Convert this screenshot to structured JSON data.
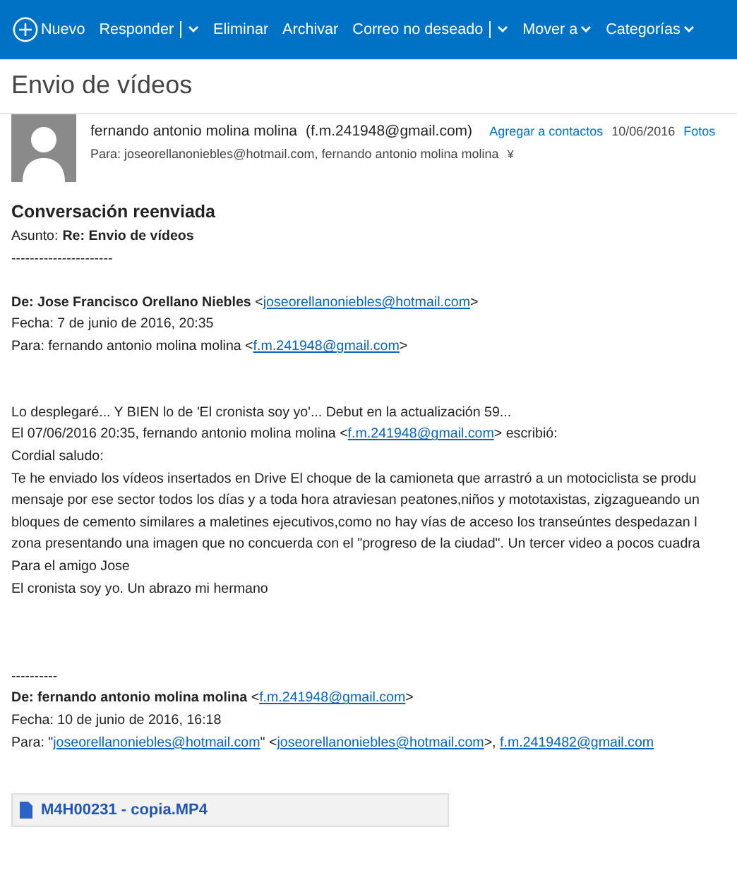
{
  "toolbar": [
    {
      "label": "Nuevo",
      "kind": "new"
    },
    {
      "label": "Responder",
      "kind": "split"
    },
    {
      "label": "Eliminar",
      "kind": "plain"
    },
    {
      "label": "Archivar",
      "kind": "plain"
    },
    {
      "label": "Correo no deseado",
      "kind": "split"
    },
    {
      "label": "Mover a",
      "kind": "menu"
    },
    {
      "label": "Categorías",
      "kind": "menu"
    }
  ],
  "subject": "Envio de vídeos",
  "message_header": {
    "sender": "fernando antonio molina molina",
    "sender_email": "(f.m.241948@gmail.com)",
    "add_contact": "Agregar a contactos",
    "date": "10/06/2016",
    "photos": "Fotos",
    "recipients": "Para: joseorellanoniebles@hotmail.com, fernando antonio molina molina",
    "expand": "¥"
  },
  "body": [
    {
      "kind": "heading",
      "parts": [
        {
          "kind": "bold",
          "text": "Conversación reenviada"
        }
      ]
    },
    {
      "kind": "line",
      "parts": [
        {
          "kind": "text",
          "text": "Asunto:"
        },
        {
          "kind": "bold",
          "text": "Re: Envio de vídeos"
        }
      ]
    },
    {
      "kind": "line",
      "parts": [
        {
          "kind": "text",
          "text": "----------------------"
        }
      ]
    },
    {
      "kind": "gap"
    },
    {
      "kind": "line",
      "parts": [
        {
          "kind": "bold",
          "text": "De: Jose Francisco Orellano Niebles"
        },
        {
          "kind": "text",
          "text": " <"
        },
        {
          "kind": "link",
          "text": "joseorellanoniebles@hotmail.com"
        },
        {
          "kind": "text",
          "text": ">"
        }
      ]
    },
    {
      "kind": "line",
      "parts": [
        {
          "kind": "text",
          "text": "Fecha: 7 de junio de 2016, 20:35"
        }
      ]
    },
    {
      "kind": "line",
      "parts": [
        {
          "kind": "text",
          "text": "Para: fernando antonio molina molina <"
        },
        {
          "kind": "link",
          "text": "f.m.241948@gmail.com"
        },
        {
          "kind": "text",
          "text": ">"
        }
      ]
    },
    {
      "kind": "gap"
    },
    {
      "kind": "gap"
    },
    {
      "kind": "line",
      "parts": [
        {
          "kind": "text",
          "text": "Lo desplegaré... Y BIEN lo de 'El cronista soy yo'... Debut en la actualización 59..."
        }
      ]
    },
    {
      "kind": "line",
      "parts": [
        {
          "kind": "text",
          "text": "El 07/06/2016 20:35, fernando antonio molina molina <"
        },
        {
          "kind": "link",
          "text": "f.m.241948@gmail.com"
        },
        {
          "kind": "text",
          "text": "> escribió:"
        }
      ]
    },
    {
      "kind": "line",
      "parts": [
        {
          "kind": "text",
          "text": "Cordial saludo:"
        }
      ]
    },
    {
      "kind": "line",
      "parts": [
        {
          "kind": "text",
          "text": "Te he enviado los vídeos insertados en Drive El choque de la camioneta que arrastró a un motociclista se produ"
        }
      ]
    },
    {
      "kind": "line",
      "parts": [
        {
          "kind": "text",
          "text": "mensaje por ese sector todos los días y a toda hora atraviesan peatones,niños y mototaxistas, zigzagueando un"
        }
      ]
    },
    {
      "kind": "line",
      "parts": [
        {
          "kind": "text",
          "text": "bloques de cemento similares a maletines ejecutivos,como no hay vías de acceso los transeúntes despedazan l"
        }
      ]
    },
    {
      "kind": "line",
      "parts": [
        {
          "kind": "text",
          "text": "zona presentando una imagen que no concuerda con el \"progreso de la ciudad\". Un tercer video a pocos cuadra"
        }
      ]
    },
    {
      "kind": "line",
      "parts": [
        {
          "kind": "text",
          "text": "Para el amigo Jose"
        }
      ]
    },
    {
      "kind": "line",
      "parts": [
        {
          "kind": "text",
          "text": "El cronista soy yo. Un abrazo mi hermano"
        }
      ]
    },
    {
      "kind": "gap"
    },
    {
      "kind": "gap"
    },
    {
      "kind": "gap"
    },
    {
      "kind": "line",
      "parts": [
        {
          "kind": "text",
          "text": "----------"
        }
      ]
    },
    {
      "kind": "line",
      "parts": [
        {
          "kind": "bold",
          "text": "De: fernando antonio molina molina"
        },
        {
          "kind": "text",
          "text": " <"
        },
        {
          "kind": "link",
          "text": "f.m.241948@gmail.com"
        },
        {
          "kind": "text",
          "text": ">"
        }
      ]
    },
    {
      "kind": "line",
      "parts": [
        {
          "kind": "text",
          "text": "Fecha: 10 de junio de 2016, 16:18"
        }
      ]
    },
    {
      "kind": "line",
      "parts": [
        {
          "kind": "text",
          "text": "Para: \""
        },
        {
          "kind": "link",
          "text": "joseorellanoniebles@hotmail.com"
        },
        {
          "kind": "text",
          "text": "\" <"
        },
        {
          "kind": "link",
          "text": "joseorellanoniebles@hotmail.com"
        },
        {
          "kind": "text",
          "text": ">, "
        },
        {
          "kind": "link",
          "text": "f.m.2419482@gmail.com"
        }
      ]
    }
  ],
  "attachments": [
    {
      "name": "M4H00231 - copia.MP4"
    }
  ]
}
